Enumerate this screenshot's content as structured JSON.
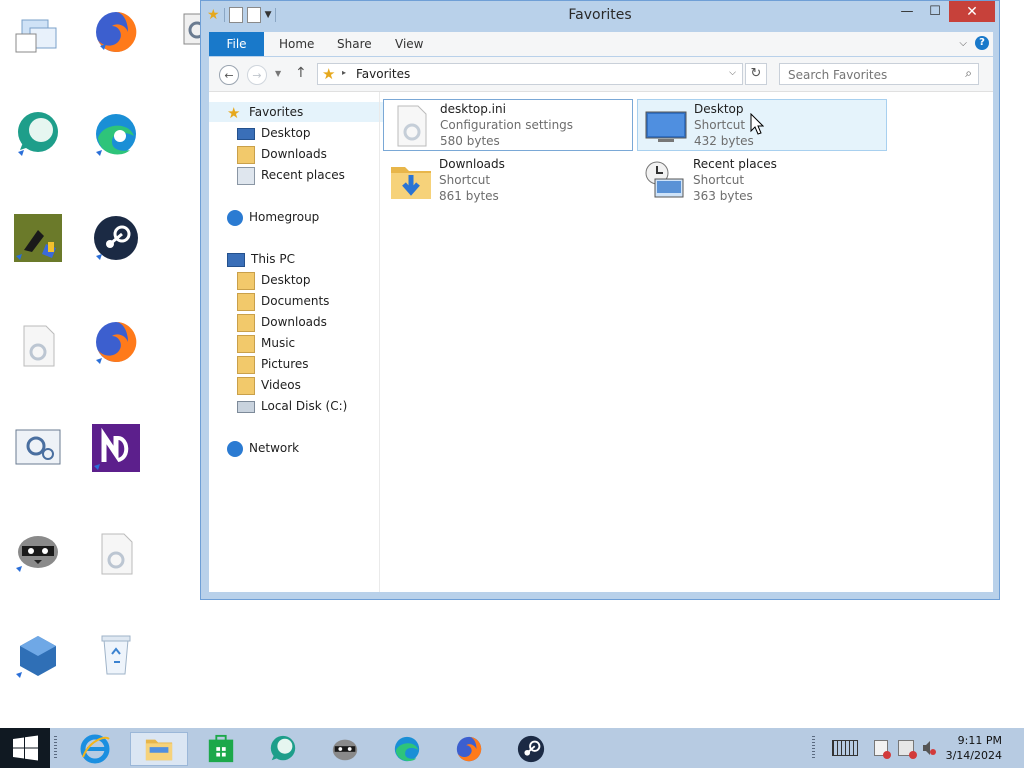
{
  "window": {
    "title": "Favorites",
    "controls": {
      "minimize": "—",
      "maximize": "☐",
      "close": "✕"
    }
  },
  "ribbon": {
    "tabs": [
      {
        "label": "File"
      },
      {
        "label": "Home"
      },
      {
        "label": "Share"
      },
      {
        "label": "View"
      }
    ]
  },
  "address_bar": {
    "path": "Favorites",
    "search_placeholder": "Search Favorites"
  },
  "navigation_pane": {
    "favorites": {
      "label": "Favorites",
      "items": [
        "Desktop",
        "Downloads",
        "Recent places"
      ]
    },
    "homegroup": "Homegroup",
    "this_pc": {
      "label": "This PC",
      "items": [
        "Desktop",
        "Documents",
        "Downloads",
        "Music",
        "Pictures",
        "Videos",
        "Local Disk (C:)"
      ]
    },
    "network": "Network"
  },
  "files": [
    {
      "name": "desktop.ini",
      "type": "Configuration settings",
      "size": "580 bytes",
      "icon": "config-file-icon",
      "state": "selected"
    },
    {
      "name": "Desktop",
      "type": "Shortcut",
      "size": "432 bytes",
      "icon": "desktop-monitor-icon",
      "state": "hover"
    },
    {
      "name": "Downloads",
      "type": "Shortcut",
      "size": "861 bytes",
      "icon": "downloads-folder-icon",
      "state": "normal"
    },
    {
      "name": "Recent places",
      "type": "Shortcut",
      "size": "363 bytes",
      "icon": "recent-places-icon",
      "state": "normal"
    }
  ],
  "desktop_icons": [
    "network-windows-icon",
    "firefox-icon",
    "config-shortcut-icon",
    "chat-app-icon",
    "edge-icon",
    "chess-game-icon",
    "steam-icon",
    "ini-file-icon",
    "firefox-icon",
    "settings-app-icon",
    "notepadplusplus-icon",
    "raccoon-app-icon",
    "config-file-icon",
    "virtualbox-icon",
    "recycle-bin-icon"
  ],
  "taskbar": {
    "pinned": [
      "internet-explorer-icon",
      "file-explorer-icon",
      "store-icon",
      "chat-app-icon",
      "raccoon-app-icon",
      "edge-icon",
      "firefox-icon",
      "steam-icon"
    ],
    "clock": {
      "time": "9:11 PM",
      "date": "3/14/2024"
    }
  },
  "colors": {
    "accent": "#1979ca",
    "titlebar": "#b9d1ea",
    "close": "#c7413a",
    "selection": "#e5f3fb",
    "taskbar": "#b7cbe2"
  }
}
